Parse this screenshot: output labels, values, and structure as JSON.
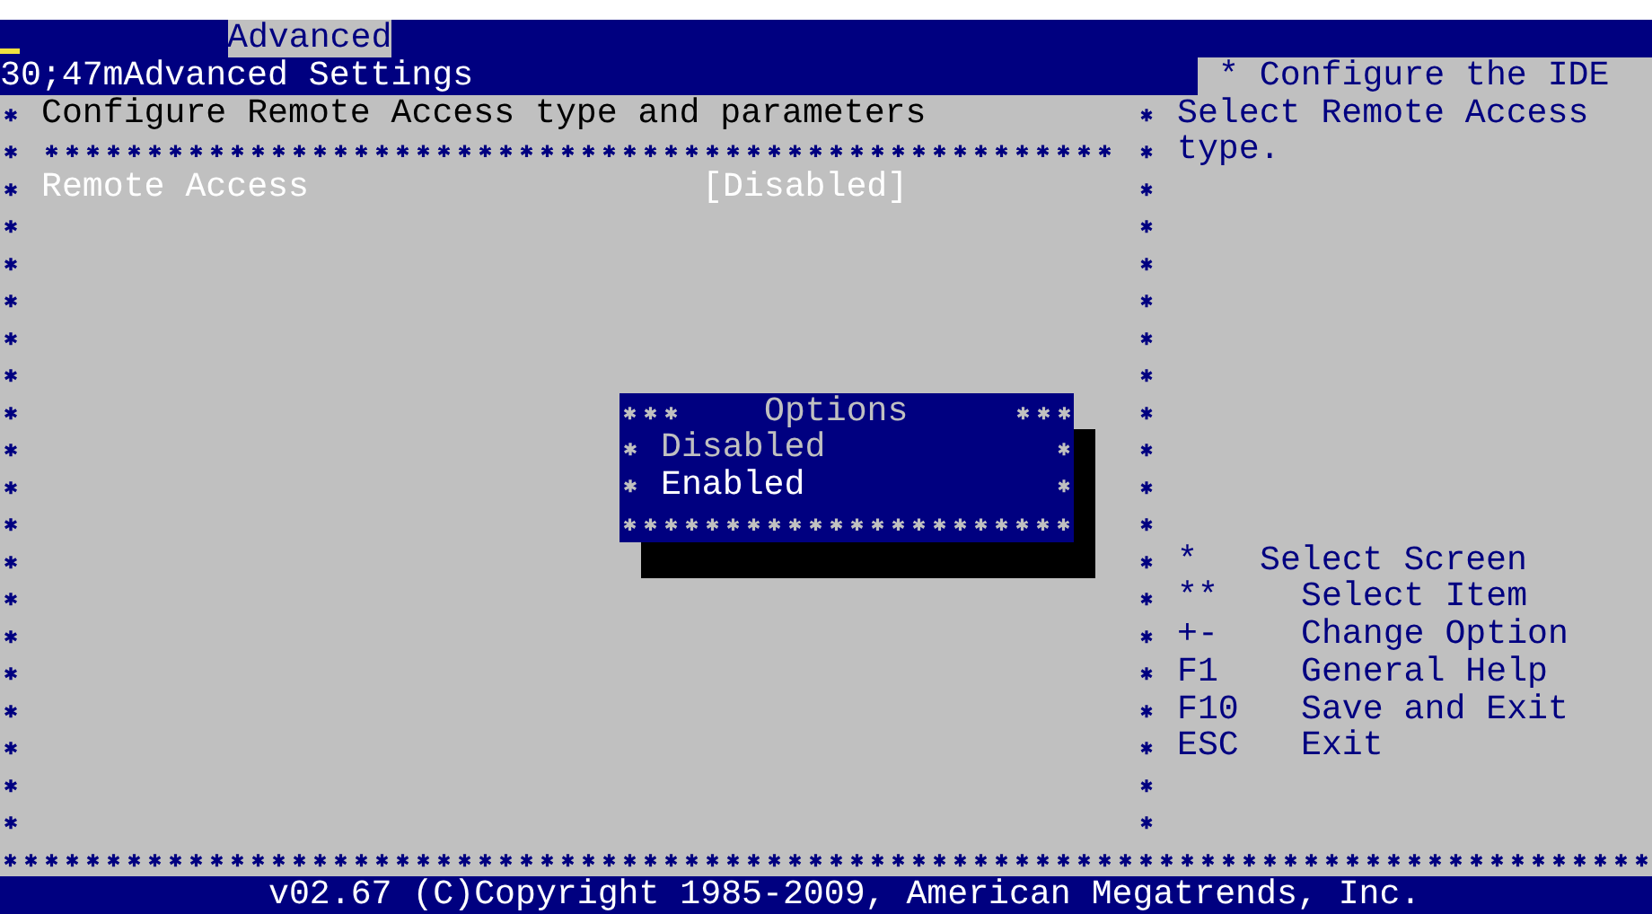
{
  "tabs": [
    {
      "label": "Advanced",
      "selected": true
    }
  ],
  "title": "30;47mAdvanced Settings",
  "section_header": "Configure Remote Access type and parameters",
  "settings": [
    {
      "label": "Remote Access",
      "value": "[Disabled]",
      "selected": true
    }
  ],
  "help": {
    "title": "* Configure the IDE",
    "text": "Select Remote Access type."
  },
  "popup": {
    "title": "Options",
    "options": [
      {
        "label": "Disabled",
        "selected": false
      },
      {
        "label": "Enabled",
        "selected": true
      }
    ]
  },
  "keys": [
    {
      "key": "*",
      "action": "Select Screen"
    },
    {
      "key": "**",
      "action": "Select Item"
    },
    {
      "key": "+-",
      "action": "Change Option"
    },
    {
      "key": "F1",
      "action": "General Help"
    },
    {
      "key": "F10",
      "action": "Save and Exit"
    },
    {
      "key": "ESC",
      "action": "Exit"
    }
  ],
  "footer": "v02.67 (C)Copyright 1985-2009, American Megatrends, Inc."
}
